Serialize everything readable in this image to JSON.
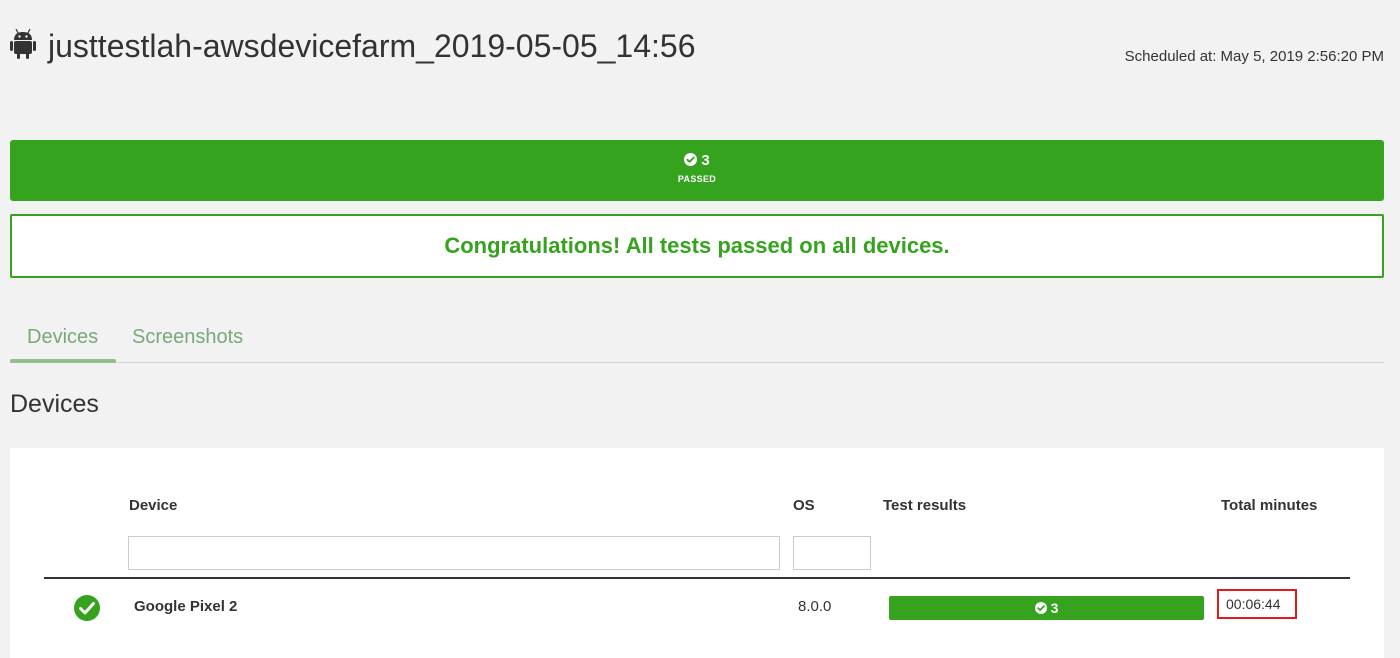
{
  "run": {
    "platform_icon": "android-icon",
    "title": "justtestlah-awsdevicefarm_2019-05-05_14:56",
    "scheduled": "Scheduled at: May 5, 2019 2:56:20 PM"
  },
  "summary": {
    "icon": "check-circle-icon",
    "count": "3",
    "label": "PASSED",
    "color": "#35a31e"
  },
  "congrats": "Congratulations! All tests passed on all devices.",
  "tabs": [
    {
      "label": "Devices",
      "active": true
    },
    {
      "label": "Screenshots",
      "active": false
    }
  ],
  "section_title": "Devices",
  "table": {
    "columns": [
      "Device",
      "OS",
      "Test results",
      "Total minutes"
    ],
    "filters": {
      "device_value": "",
      "os_value": ""
    },
    "rows": [
      {
        "status_icon": "check-circle-icon",
        "device": "Google Pixel 2",
        "os": "8.0.0",
        "results_count": "3",
        "total_minutes": "00:06:44"
      }
    ]
  },
  "colors": {
    "pass_green": "#35a31e",
    "tab_green": "#7aa87a",
    "highlight_red": "#e01b1b"
  }
}
